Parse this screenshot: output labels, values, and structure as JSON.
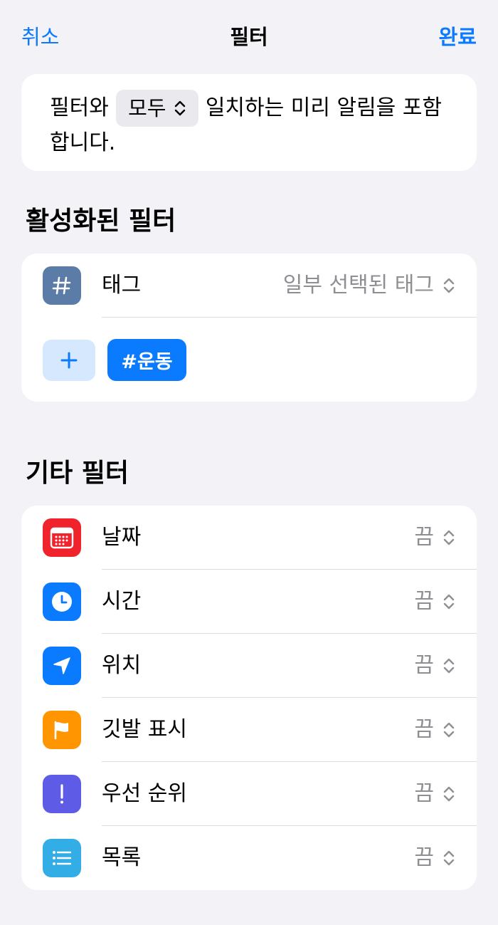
{
  "nav": {
    "cancel": "취소",
    "title": "필터",
    "done": "완료"
  },
  "match": {
    "prefix": "필터와",
    "mode": "모두",
    "suffix": "일치하는 미리 알림을 포함",
    "line2": "합니다."
  },
  "active": {
    "header": "활성화된 필터",
    "tag_row": {
      "label": "태그",
      "value": "일부 선택된 태그",
      "icon": "hashtag-icon"
    },
    "add_icon": "plus-icon",
    "chips": [
      "#운동"
    ]
  },
  "other": {
    "header": "기타 필터",
    "rows": [
      {
        "label": "날짜",
        "value": "끔",
        "icon": "calendar-icon",
        "color": "#f0232d"
      },
      {
        "label": "시간",
        "value": "끔",
        "icon": "clock-icon",
        "color": "#0a7aff"
      },
      {
        "label": "위치",
        "value": "끔",
        "icon": "location-arrow-icon",
        "color": "#0a7aff"
      },
      {
        "label": "깃발 표시",
        "value": "끔",
        "icon": "flag-icon",
        "color": "#ff9500"
      },
      {
        "label": "우선 순위",
        "value": "끔",
        "icon": "exclamation-icon",
        "color": "#5e5ce6"
      },
      {
        "label": "목록",
        "value": "끔",
        "icon": "list-icon",
        "color": "#32ade6"
      }
    ]
  },
  "colors": {
    "accent": "#0a7aff",
    "background": "#f2f2f7",
    "tag_icon": "#5b7ca6"
  }
}
